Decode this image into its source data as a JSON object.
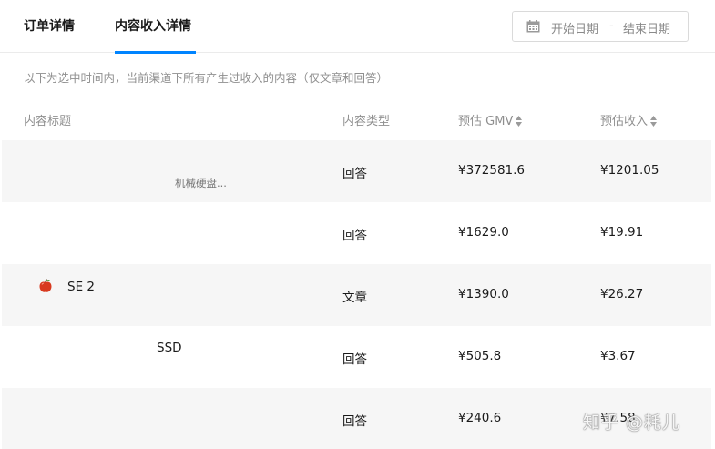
{
  "tabs": [
    {
      "label": "订单详情",
      "active": false
    },
    {
      "label": "内容收入详情",
      "active": true
    }
  ],
  "date_range": {
    "start": "开始日期",
    "separator": "-",
    "end": "结束日期",
    "icon": "calendar-icon"
  },
  "description": "以下为选中时间内，当前渠道下所有产生过收入的内容（仅文章和回答）",
  "table": {
    "headers": {
      "title": "内容标题",
      "type": "内容类型",
      "gmv": "预估 GMV",
      "income": "预估收入"
    },
    "rows": [
      {
        "title": "机械硬盘...",
        "type": "回答",
        "gmv": "¥372581.6",
        "income": "¥1201.05"
      },
      {
        "title": "",
        "type": "回答",
        "gmv": "¥1629.0",
        "income": "¥19.91"
      },
      {
        "title": "SE 2",
        "title_icon": "apple-icon",
        "type": "文章",
        "gmv": "¥1390.0",
        "income": "¥26.27"
      },
      {
        "title": "SSD",
        "type": "回答",
        "gmv": "¥505.8",
        "income": "¥3.67"
      },
      {
        "title": "",
        "type": "回答",
        "gmv": "¥240.6",
        "income": "¥7.58"
      }
    ]
  },
  "watermark": "知乎 @耗儿",
  "colors": {
    "accent": "#0084ff",
    "row_alt": "#f6f6f6",
    "muted_text": "#8f8f8f"
  }
}
